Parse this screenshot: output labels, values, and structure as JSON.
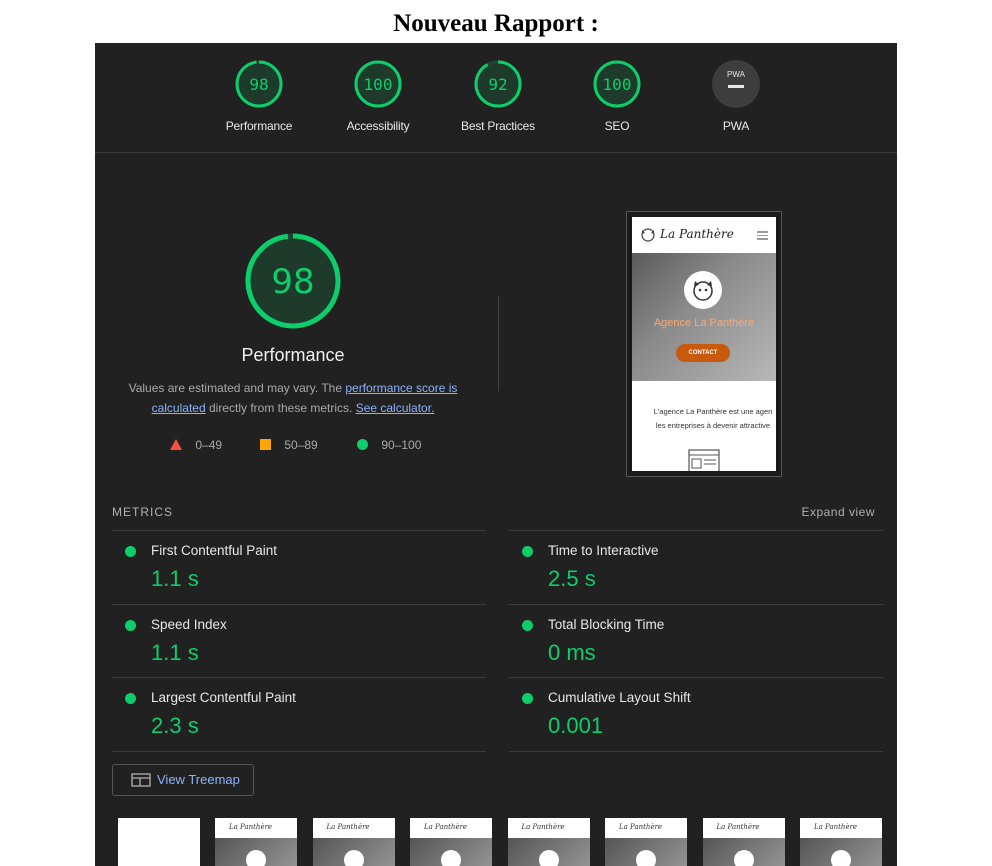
{
  "page": {
    "title": "Nouveau Rapport :"
  },
  "categories": [
    {
      "score": "98",
      "label": "Performance",
      "fraction": 0.98
    },
    {
      "score": "100",
      "label": "Accessibility",
      "fraction": 1.0
    },
    {
      "score": "92",
      "label": "Best Practices",
      "fraction": 0.92
    },
    {
      "score": "100",
      "label": "SEO",
      "fraction": 1.0
    },
    {
      "score": "PWA",
      "label": "PWA",
      "fraction": 0
    }
  ],
  "performance": {
    "score": "98",
    "fraction": 0.98,
    "title": "Performance",
    "desc_prefix": "Values are estimated and may vary. The ",
    "desc_link1": "performance score is calculated",
    "desc_middle": " directly from these metrics. ",
    "desc_link2": "See calculator."
  },
  "legend": {
    "fail": "0–49",
    "average": "50–89",
    "pass": "90–100"
  },
  "screenshot": {
    "brand": "La Panthère",
    "hero_title": "Agence La Panthère",
    "button": "CONTACT",
    "text_line1": "L'agence La Panthère est une agen",
    "text_line2": "les entreprises à devenir attractive"
  },
  "metrics": {
    "header": "METRICS",
    "expand": "Expand view",
    "items": [
      {
        "label": "First Contentful Paint",
        "value": "1.1 s"
      },
      {
        "label": "Time to Interactive",
        "value": "2.5 s"
      },
      {
        "label": "Speed Index",
        "value": "1.1 s"
      },
      {
        "label": "Total Blocking Time",
        "value": "0 ms"
      },
      {
        "label": "Largest Contentful Paint",
        "value": "2.3 s"
      },
      {
        "label": "Cumulative Layout Shift",
        "value": "0.001"
      }
    ]
  },
  "treemap": {
    "label": "View Treemap"
  },
  "filmstrip": {
    "brand": "La Panthère"
  },
  "colors": {
    "pass": "#0cce6b",
    "average": "#ffa400",
    "fail": "#ff4e42",
    "background": "#212121",
    "link": "#8ab4f8"
  }
}
